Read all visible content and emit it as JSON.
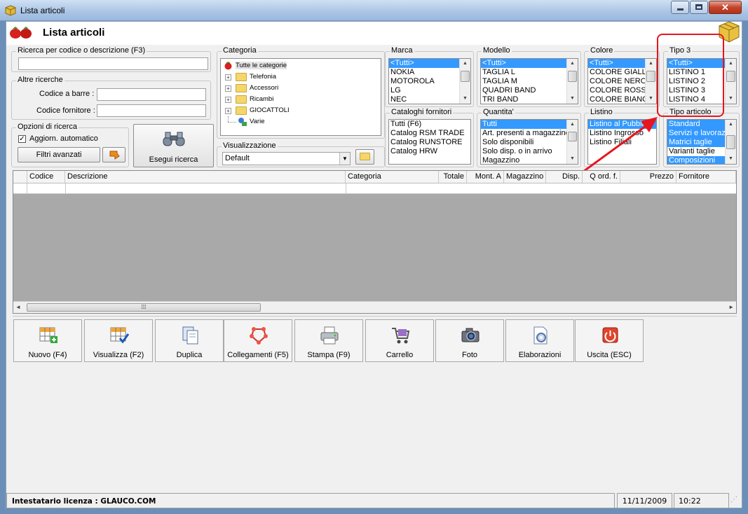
{
  "window": {
    "title": "Lista articoli"
  },
  "header": {
    "title": "Lista articoli"
  },
  "search": {
    "group_label": "Ricerca per codice o descrizione (F3)",
    "value": "",
    "other_group_label": "Altre ricerche",
    "barcode_label": "Codice a barre :",
    "supplier_code_label": "Codice fornitore :"
  },
  "options": {
    "group_label": "Opzioni di ricerca",
    "auto_update_label": "Aggiorn. automatico",
    "auto_update_checked": true,
    "advanced_filters_label": "Filtri avanzati"
  },
  "run_search_label": "Esegui ricerca",
  "category": {
    "group_label": "Categoria",
    "root": "Tutte le categorie",
    "items": [
      {
        "label": "Telefonia",
        "expandable": true
      },
      {
        "label": "Accessori",
        "expandable": true
      },
      {
        "label": "Ricambi",
        "expandable": true
      },
      {
        "label": "GIOCATTOLI",
        "expandable": true
      },
      {
        "label": "Varie",
        "expandable": false
      }
    ]
  },
  "view": {
    "group_label": "Visualizzazione",
    "selected": "Default"
  },
  "filters": {
    "marca": {
      "label": "Marca",
      "items": [
        "<Tutti>",
        "NOKIA",
        "MOTOROLA",
        "LG",
        "NEC"
      ]
    },
    "modello": {
      "label": "Modello",
      "items": [
        "<Tutti>",
        "TAGLIA L",
        "TAGLIA M",
        "QUADRI BAND",
        "TRI BAND"
      ]
    },
    "colore": {
      "label": "Colore",
      "items": [
        "<Tutti>",
        "COLORE GIALLO",
        "COLORE NERO",
        "COLORE ROSSO",
        "COLORE BIANCO"
      ]
    },
    "tipo3": {
      "label": "Tipo 3",
      "items": [
        "<Tutti>",
        "LISTINO 1",
        "LISTINO 2",
        "LISTINO 3",
        "LISTINO 4"
      ]
    },
    "cataloghi": {
      "label": "Cataloghi fornitori",
      "items": [
        "Tutti (F6)",
        "Catalog RSM TRADE",
        "Catalog RUNSTORE",
        "Catalog HRW"
      ]
    },
    "quantita": {
      "label": "Quantita'",
      "items": [
        "Tutti",
        "Art. presenti a magazzino",
        "Solo disponibili",
        "Solo disp. o in arrivo",
        "Magazzino"
      ]
    },
    "listino": {
      "label": "Listino",
      "items": [
        "Listino al Pubblico",
        "Listino Ingrosso",
        "Listino Filiali"
      ]
    },
    "tipo_articolo": {
      "label": "Tipo articolo",
      "items": [
        "Standard",
        "Servizi e lavorazioni",
        "Matrici taglie",
        "Varianti taglie",
        "Composizioni"
      ],
      "selected": [
        0,
        1,
        2,
        4
      ]
    }
  },
  "grid": {
    "columns": [
      "Codice",
      "Descrizione",
      "Categoria",
      "Totale",
      "Mont. A",
      "Magazzino",
      "Disp.",
      "Q ord. f.",
      "Prezzo",
      "Fornitore"
    ]
  },
  "toolbar": [
    {
      "label": "Nuovo (F4)",
      "icon": "grid-add-icon"
    },
    {
      "label": "Visualizza (F2)",
      "icon": "grid-check-icon"
    },
    {
      "label": "Duplica",
      "icon": "duplicate-icon"
    },
    {
      "label": "Collegamenti (F5)",
      "icon": "links-icon"
    },
    {
      "label": "Stampa (F9)",
      "icon": "printer-icon"
    },
    {
      "label": "Carrello",
      "icon": "cart-icon"
    },
    {
      "label": "Foto",
      "icon": "camera-icon"
    },
    {
      "label": "Elaborazioni",
      "icon": "process-icon"
    },
    {
      "label": "Uscita (ESC)",
      "icon": "exit-icon"
    }
  ],
  "status": {
    "license": "Intestatario licenza : GLAUCO.COM",
    "date": "11/11/2009",
    "time": "10:22"
  },
  "colors": {
    "selection": "#3399ff",
    "highlight": "#e8141e",
    "grid_body": "#a9a9a9"
  }
}
